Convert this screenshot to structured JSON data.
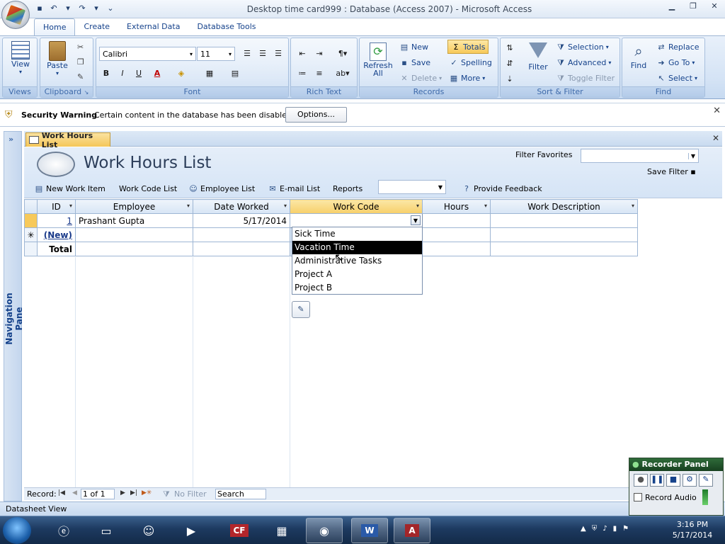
{
  "window": {
    "title": "Desktop time card999 : Database (Access 2007) - Microsoft Access",
    "controls": [
      "minimize-icon",
      "restore-icon",
      "close-icon"
    ]
  },
  "ribbon_tabs": [
    "Home",
    "Create",
    "External Data",
    "Database Tools"
  ],
  "ribbon": {
    "views": {
      "view_label": "View",
      "group": "Views"
    },
    "clipboard": {
      "paste_label": "Paste",
      "group": "Clipboard"
    },
    "font": {
      "family": "Calibri",
      "size": "11",
      "group": "Font"
    },
    "rich_text": {
      "group": "Rich Text"
    },
    "records": {
      "refresh_label": "Refresh All",
      "new_label": "New",
      "save_label": "Save",
      "delete_label": "Delete",
      "totals_label": "Totals",
      "spelling_label": "Spelling",
      "more_label": "More",
      "group": "Records"
    },
    "sort_filter": {
      "filter_label": "Filter",
      "selection_label": "Selection",
      "advanced_label": "Advanced",
      "toggle_filter_label": "Toggle Filter",
      "group": "Sort & Filter"
    },
    "find": {
      "find_label": "Find",
      "replace_label": "Replace",
      "goto_label": "Go To",
      "select_label": "Select",
      "group": "Find"
    }
  },
  "security": {
    "title": "Security Warning",
    "message": "Certain content in the database has been disabled",
    "options_label": "Options..."
  },
  "nav_pane": {
    "label": "Navigation Pane"
  },
  "document": {
    "tab_label": "Work Hours List",
    "form_title": "Work Hours List",
    "filter_favorites_label": "Filter Favorites",
    "save_filter_label": "Save Filter",
    "toolbar": {
      "new_work_item": "New Work Item",
      "work_code_list": "Work Code List",
      "employee_list": "Employee List",
      "email_list": "E-mail List",
      "reports": "Reports",
      "provide_feedback": "Provide Feedback"
    }
  },
  "table": {
    "columns": [
      "ID",
      "Employee",
      "Date Worked",
      "Work Code",
      "Hours",
      "Work Description"
    ],
    "rows": [
      {
        "id": "1",
        "employee": "Prashant Gupta",
        "date": "5/17/2014",
        "work_code": "",
        "hours": "",
        "description": ""
      }
    ],
    "new_row_label": "(New)",
    "total_label": "Total"
  },
  "work_code_dropdown": {
    "options": [
      "Sick Time",
      "Vacation Time",
      "Administrative Tasks",
      "Project A",
      "Project B"
    ],
    "highlighted": "Vacation Time"
  },
  "record_nav": {
    "label": "Record:",
    "position": "1 of 1",
    "no_filter_label": "No Filter",
    "search_placeholder": "Search"
  },
  "status_bar": {
    "view": "Datasheet View"
  },
  "recorder": {
    "title": "Recorder Panel",
    "record_audio_label": "Record Audio"
  },
  "taskbar": {
    "apps": [
      "ie-icon",
      "explorer-icon",
      "messenger-icon",
      "media-icon",
      "coldfusion-icon",
      "calculator-icon",
      "chrome-icon",
      "word-icon",
      "access-icon"
    ],
    "time": "3:16 PM",
    "date": "5/17/2014"
  },
  "colors": {
    "accent": "#15428b",
    "ribbon_bg": "#d4e3f5",
    "highlight": "#000000",
    "doc_tab": "#f4c659"
  }
}
